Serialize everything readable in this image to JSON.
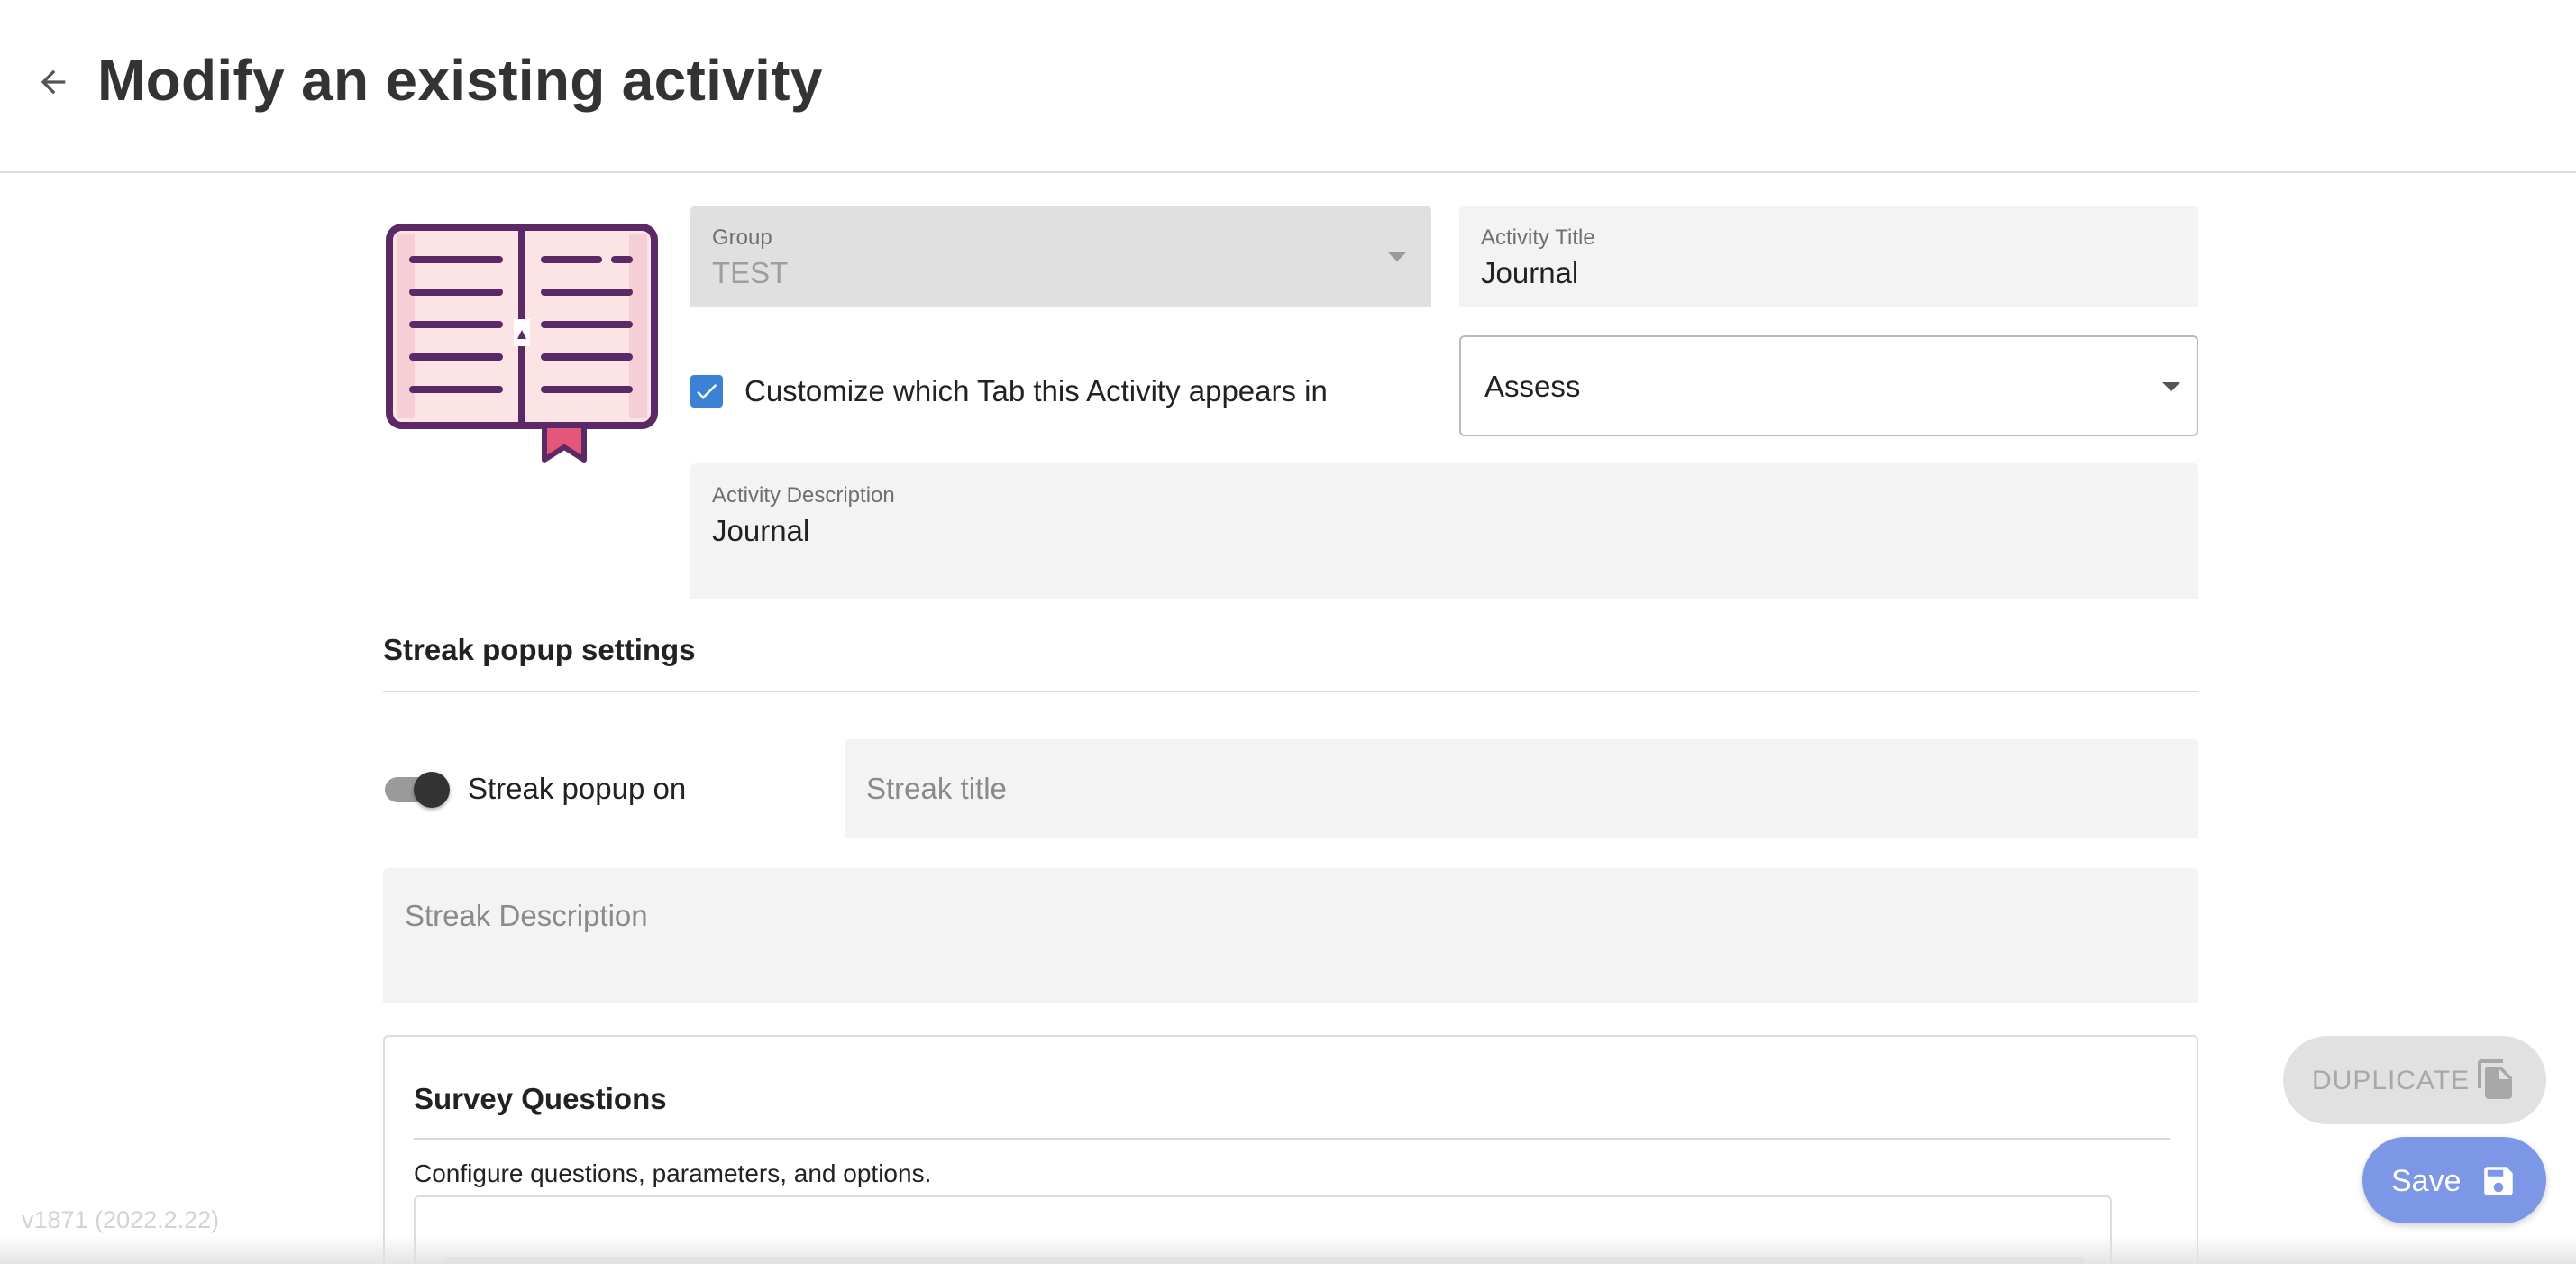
{
  "header": {
    "title": "Modify an existing activity",
    "back_icon": "arrow-left-icon"
  },
  "activity_icon": "open-book-icon",
  "form": {
    "group": {
      "label": "Group",
      "value": "TEST",
      "disabled": true
    },
    "activity_title": {
      "label": "Activity Title",
      "value": "Journal"
    },
    "customize_tab": {
      "label": "Customize which Tab this Activity appears in",
      "checked": true
    },
    "tab_select": {
      "value": "Assess"
    },
    "activity_description": {
      "label": "Activity Description",
      "value": "Journal"
    }
  },
  "streak": {
    "heading": "Streak popup settings",
    "toggle_label": "Streak popup on",
    "toggle_on": true,
    "title_placeholder": "Streak title",
    "description_placeholder": "Streak Description"
  },
  "survey": {
    "title": "Survey Questions",
    "subtitle": "Configure questions, parameters, and options."
  },
  "version": "v1871 (2022.2.22)",
  "buttons": {
    "duplicate": "DUPLICATE",
    "save": "Save"
  },
  "colors": {
    "accent": "#3b82d6",
    "save_button": "#7b97e6",
    "book_outline": "#5b2a66",
    "book_fill": "#fbe3e6",
    "bookmark": "#e4577a"
  }
}
